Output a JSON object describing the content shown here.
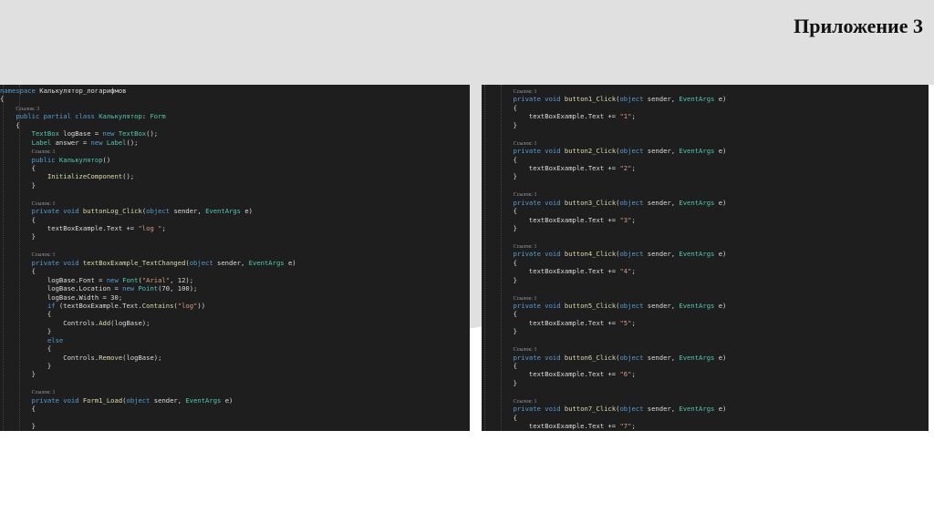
{
  "slide": {
    "title": "Приложение 3"
  },
  "left_code": [
    [
      [
        "namespace ",
        "kw"
      ],
      [
        "Калькулятор_логарифмов",
        "pl"
      ]
    ],
    [
      [
        "{",
        "pl"
      ]
    ],
    [
      [
        "    ",
        ""
      ],
      [
        "Ссылок: 3",
        "cm"
      ]
    ],
    [
      [
        "    ",
        ""
      ],
      [
        "public partial class ",
        "kw"
      ],
      [
        "Калькулятор",
        "ty"
      ],
      [
        ": ",
        "pl"
      ],
      [
        "Form",
        "ty"
      ]
    ],
    [
      [
        "    {",
        "pl"
      ]
    ],
    [
      [
        "        ",
        ""
      ],
      [
        "TextBox ",
        "ty"
      ],
      [
        "logBase = ",
        "pl"
      ],
      [
        "new ",
        "kw"
      ],
      [
        "TextBox",
        "ty"
      ],
      [
        "();",
        "pl"
      ]
    ],
    [
      [
        "        ",
        ""
      ],
      [
        "Label ",
        "ty"
      ],
      [
        "answer = ",
        "pl"
      ],
      [
        "new ",
        "kw"
      ],
      [
        "Label",
        "ty"
      ],
      [
        "();",
        "pl"
      ]
    ],
    [
      [
        "        ",
        ""
      ],
      [
        "Ссылок: 1",
        "cm"
      ]
    ],
    [
      [
        "        ",
        ""
      ],
      [
        "public ",
        "kw"
      ],
      [
        "Калькулятор",
        "ty"
      ],
      [
        "()",
        "pl"
      ]
    ],
    [
      [
        "        {",
        "pl"
      ]
    ],
    [
      [
        "            ",
        ""
      ],
      [
        "InitializeComponent",
        "me"
      ],
      [
        "();",
        "pl"
      ]
    ],
    [
      [
        "        }",
        "pl"
      ]
    ],
    [
      [
        "",
        ""
      ]
    ],
    [
      [
        "        ",
        ""
      ],
      [
        "Ссылок: 1",
        "cm"
      ]
    ],
    [
      [
        "        ",
        ""
      ],
      [
        "private void ",
        "kw"
      ],
      [
        "buttonLog_Click",
        "me"
      ],
      [
        "(",
        "pl"
      ],
      [
        "object ",
        "kw"
      ],
      [
        "sender, ",
        "pl"
      ],
      [
        "EventArgs ",
        "ty"
      ],
      [
        "e)",
        "pl"
      ]
    ],
    [
      [
        "        {",
        "pl"
      ]
    ],
    [
      [
        "            textBoxExample.Text += ",
        "pl"
      ],
      [
        "\"log \"",
        "st"
      ],
      [
        ";",
        "pl"
      ]
    ],
    [
      [
        "        }",
        "pl"
      ]
    ],
    [
      [
        "",
        ""
      ]
    ],
    [
      [
        "        ",
        ""
      ],
      [
        "Ссылок: 1",
        "cm"
      ]
    ],
    [
      [
        "        ",
        ""
      ],
      [
        "private void ",
        "kw"
      ],
      [
        "textBoxExample_TextChanged",
        "me"
      ],
      [
        "(",
        "pl"
      ],
      [
        "object ",
        "kw"
      ],
      [
        "sender, ",
        "pl"
      ],
      [
        "EventArgs ",
        "ty"
      ],
      [
        "e)",
        "pl"
      ]
    ],
    [
      [
        "        {",
        "pl"
      ]
    ],
    [
      [
        "            logBase.Font = ",
        "pl"
      ],
      [
        "new ",
        "kw"
      ],
      [
        "Font",
        "ty"
      ],
      [
        "(",
        "pl"
      ],
      [
        "\"Arial\"",
        "st"
      ],
      [
        ", 12);",
        "pl"
      ]
    ],
    [
      [
        "            logBase.Location = ",
        "pl"
      ],
      [
        "new ",
        "kw"
      ],
      [
        "Point",
        "ty"
      ],
      [
        "(70, 100);",
        "pl"
      ]
    ],
    [
      [
        "            logBase.Width = 30;",
        "pl"
      ]
    ],
    [
      [
        "            ",
        ""
      ],
      [
        "if ",
        "kw"
      ],
      [
        "(textBoxExample.Text.",
        "pl"
      ],
      [
        "Contains",
        "me"
      ],
      [
        "(",
        "pl"
      ],
      [
        "\"log\"",
        "st"
      ],
      [
        "))",
        "pl"
      ]
    ],
    [
      [
        "            {",
        "pl"
      ]
    ],
    [
      [
        "                Controls.",
        "pl"
      ],
      [
        "Add",
        "me"
      ],
      [
        "(logBase);",
        "pl"
      ]
    ],
    [
      [
        "            }",
        "pl"
      ]
    ],
    [
      [
        "            ",
        ""
      ],
      [
        "else",
        "kw"
      ]
    ],
    [
      [
        "            {",
        "pl"
      ]
    ],
    [
      [
        "                Controls.",
        "pl"
      ],
      [
        "Remove",
        "me"
      ],
      [
        "(logBase);",
        "pl"
      ]
    ],
    [
      [
        "            }",
        "pl"
      ]
    ],
    [
      [
        "        }",
        "pl"
      ]
    ],
    [
      [
        "",
        ""
      ]
    ],
    [
      [
        "        ",
        ""
      ],
      [
        "Ссылок: 1",
        "cm"
      ]
    ],
    [
      [
        "        ",
        ""
      ],
      [
        "private void ",
        "kw"
      ],
      [
        "Form1_Load",
        "me"
      ],
      [
        "(",
        "pl"
      ],
      [
        "object ",
        "kw"
      ],
      [
        "sender, ",
        "pl"
      ],
      [
        "EventArgs ",
        "ty"
      ],
      [
        "e)",
        "pl"
      ]
    ],
    [
      [
        "        {",
        "pl"
      ]
    ],
    [
      [
        "",
        ""
      ]
    ],
    [
      [
        "        }",
        "pl"
      ]
    ]
  ],
  "right_code": [
    [
      [
        "        ",
        ""
      ],
      [
        "Ссылок: 1",
        "cm"
      ]
    ],
    [
      [
        "        ",
        ""
      ],
      [
        "private void ",
        "kw"
      ],
      [
        "button1_Click",
        "me"
      ],
      [
        "(",
        "pl"
      ],
      [
        "object ",
        "kw"
      ],
      [
        "sender, ",
        "pl"
      ],
      [
        "EventArgs ",
        "ty"
      ],
      [
        "e)",
        "pl"
      ]
    ],
    [
      [
        "        {",
        "pl"
      ]
    ],
    [
      [
        "            textBoxExample.Text += ",
        "pl"
      ],
      [
        "\"1\"",
        "st"
      ],
      [
        ";",
        "pl"
      ]
    ],
    [
      [
        "        }",
        "pl"
      ]
    ],
    [
      [
        "",
        ""
      ]
    ],
    [
      [
        "        ",
        ""
      ],
      [
        "Ссылок: 1",
        "cm"
      ]
    ],
    [
      [
        "        ",
        ""
      ],
      [
        "private void ",
        "kw"
      ],
      [
        "button2_Click",
        "me"
      ],
      [
        "(",
        "pl"
      ],
      [
        "object ",
        "kw"
      ],
      [
        "sender, ",
        "pl"
      ],
      [
        "EventArgs ",
        "ty"
      ],
      [
        "e)",
        "pl"
      ]
    ],
    [
      [
        "        {",
        "pl"
      ]
    ],
    [
      [
        "            textBoxExample.Text += ",
        "pl"
      ],
      [
        "\"2\"",
        "st"
      ],
      [
        ";",
        "pl"
      ]
    ],
    [
      [
        "        }",
        "pl"
      ]
    ],
    [
      [
        "",
        ""
      ]
    ],
    [
      [
        "        ",
        ""
      ],
      [
        "Ссылок: 1",
        "cm"
      ]
    ],
    [
      [
        "        ",
        ""
      ],
      [
        "private void ",
        "kw"
      ],
      [
        "button3_Click",
        "me"
      ],
      [
        "(",
        "pl"
      ],
      [
        "object ",
        "kw"
      ],
      [
        "sender, ",
        "pl"
      ],
      [
        "EventArgs ",
        "ty"
      ],
      [
        "e)",
        "pl"
      ]
    ],
    [
      [
        "        {",
        "pl"
      ]
    ],
    [
      [
        "            textBoxExample.Text += ",
        "pl"
      ],
      [
        "\"3\"",
        "st"
      ],
      [
        ";",
        "pl"
      ]
    ],
    [
      [
        "        }",
        "pl"
      ]
    ],
    [
      [
        "",
        ""
      ]
    ],
    [
      [
        "        ",
        ""
      ],
      [
        "Ссылок: 1",
        "cm"
      ]
    ],
    [
      [
        "        ",
        ""
      ],
      [
        "private void ",
        "kw"
      ],
      [
        "button4_Click",
        "me"
      ],
      [
        "(",
        "pl"
      ],
      [
        "object ",
        "kw"
      ],
      [
        "sender, ",
        "pl"
      ],
      [
        "EventArgs ",
        "ty"
      ],
      [
        "e)",
        "pl"
      ]
    ],
    [
      [
        "        {",
        "pl"
      ]
    ],
    [
      [
        "            textBoxExample.Text += ",
        "pl"
      ],
      [
        "\"4\"",
        "st"
      ],
      [
        ";",
        "pl"
      ]
    ],
    [
      [
        "        }",
        "pl"
      ]
    ],
    [
      [
        "",
        ""
      ]
    ],
    [
      [
        "        ",
        ""
      ],
      [
        "Ссылок: 1",
        "cm"
      ]
    ],
    [
      [
        "        ",
        ""
      ],
      [
        "private void ",
        "kw"
      ],
      [
        "button5_Click",
        "me"
      ],
      [
        "(",
        "pl"
      ],
      [
        "object ",
        "kw"
      ],
      [
        "sender, ",
        "pl"
      ],
      [
        "EventArgs ",
        "ty"
      ],
      [
        "e)",
        "pl"
      ]
    ],
    [
      [
        "        {",
        "pl"
      ]
    ],
    [
      [
        "            textBoxExample.Text += ",
        "pl"
      ],
      [
        "\"5\"",
        "st"
      ],
      [
        ";",
        "pl"
      ]
    ],
    [
      [
        "        }",
        "pl"
      ]
    ],
    [
      [
        "",
        ""
      ]
    ],
    [
      [
        "        ",
        ""
      ],
      [
        "Ссылок: 1",
        "cm"
      ]
    ],
    [
      [
        "        ",
        ""
      ],
      [
        "private void ",
        "kw"
      ],
      [
        "button6_Click",
        "me"
      ],
      [
        "(",
        "pl"
      ],
      [
        "object ",
        "kw"
      ],
      [
        "sender, ",
        "pl"
      ],
      [
        "EventArgs ",
        "ty"
      ],
      [
        "e)",
        "pl"
      ]
    ],
    [
      [
        "        {",
        "pl"
      ]
    ],
    [
      [
        "            textBoxExample.Text += ",
        "pl"
      ],
      [
        "\"6\"",
        "st"
      ],
      [
        ";",
        "pl"
      ]
    ],
    [
      [
        "        }",
        "pl"
      ]
    ],
    [
      [
        "",
        ""
      ]
    ],
    [
      [
        "        ",
        ""
      ],
      [
        "Ссылок: 1",
        "cm"
      ]
    ],
    [
      [
        "        ",
        ""
      ],
      [
        "private void ",
        "kw"
      ],
      [
        "button7_Click",
        "me"
      ],
      [
        "(",
        "pl"
      ],
      [
        "object ",
        "kw"
      ],
      [
        "sender, ",
        "pl"
      ],
      [
        "EventArgs ",
        "ty"
      ],
      [
        "e)",
        "pl"
      ]
    ],
    [
      [
        "        {",
        "pl"
      ]
    ],
    [
      [
        "            textBoxExample.Text += ",
        "pl"
      ],
      [
        "\"7\"",
        "st"
      ],
      [
        ";",
        "pl"
      ]
    ],
    [
      [
        "        }",
        "pl"
      ]
    ]
  ]
}
